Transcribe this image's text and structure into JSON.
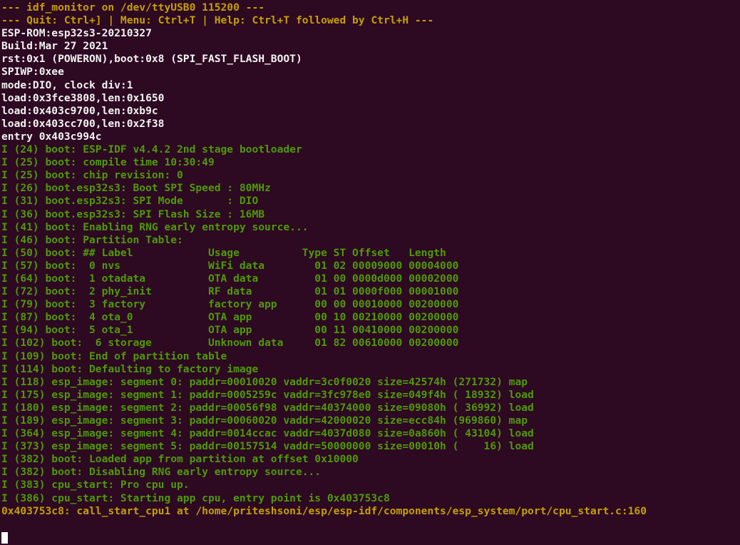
{
  "terminal": {
    "background_color": "#2d0922",
    "colors": {
      "yellow": "#c4a000",
      "white": "#f2f2f2",
      "green": "#4e9a06",
      "cursor": "#ffffff"
    },
    "device": "/dev/ttyUSB0",
    "baud": "115200",
    "cursor_glyph": "block-cursor"
  },
  "lines": [
    {
      "color": "yellow",
      "text": "--- idf_monitor on /dev/ttyUSB0 115200 ---"
    },
    {
      "color": "yellow",
      "text": "--- Quit: Ctrl+] | Menu: Ctrl+T | Help: Ctrl+T followed by Ctrl+H ---"
    },
    {
      "color": "white",
      "text": "ESP-ROM:esp32s3-20210327"
    },
    {
      "color": "white",
      "text": "Build:Mar 27 2021"
    },
    {
      "color": "white",
      "text": "rst:0x1 (POWERON),boot:0x8 (SPI_FAST_FLASH_BOOT)"
    },
    {
      "color": "white",
      "text": "SPIWP:0xee"
    },
    {
      "color": "white",
      "text": "mode:DIO, clock div:1"
    },
    {
      "color": "white",
      "text": "load:0x3fce3808,len:0x1650"
    },
    {
      "color": "white",
      "text": "load:0x403c9700,len:0xb9c"
    },
    {
      "color": "white",
      "text": "load:0x403cc700,len:0x2f38"
    },
    {
      "color": "white",
      "text": "entry 0x403c994c"
    },
    {
      "color": "green",
      "text": "I (24) boot: ESP-IDF v4.4.2 2nd stage bootloader"
    },
    {
      "color": "green",
      "text": "I (25) boot: compile time 10:30:49"
    },
    {
      "color": "green",
      "text": "I (25) boot: chip revision: 0"
    },
    {
      "color": "green",
      "text": "I (26) boot.esp32s3: Boot SPI Speed : 80MHz"
    },
    {
      "color": "green",
      "text": "I (31) boot.esp32s3: SPI Mode       : DIO"
    },
    {
      "color": "green",
      "text": "I (36) boot.esp32s3: SPI Flash Size : 16MB"
    },
    {
      "color": "green",
      "text": "I (41) boot: Enabling RNG early entropy source..."
    },
    {
      "color": "green",
      "text": "I (46) boot: Partition Table:"
    },
    {
      "color": "green",
      "text": "I (50) boot: ## Label            Usage          Type ST Offset   Length"
    },
    {
      "color": "green",
      "text": "I (57) boot:  0 nvs              WiFi data        01 02 00009000 00004000"
    },
    {
      "color": "green",
      "text": "I (64) boot:  1 otadata          OTA data         01 00 0000d000 00002000"
    },
    {
      "color": "green",
      "text": "I (72) boot:  2 phy_init         RF data          01 01 0000f000 00001000"
    },
    {
      "color": "green",
      "text": "I (79) boot:  3 factory          factory app      00 00 00010000 00200000"
    },
    {
      "color": "green",
      "text": "I (87) boot:  4 ota_0            OTA app          00 10 00210000 00200000"
    },
    {
      "color": "green",
      "text": "I (94) boot:  5 ota_1            OTA app          00 11 00410000 00200000"
    },
    {
      "color": "green",
      "text": "I (102) boot:  6 storage         Unknown data     01 82 00610000 00200000"
    },
    {
      "color": "green",
      "text": "I (109) boot: End of partition table"
    },
    {
      "color": "green",
      "text": "I (114) boot: Defaulting to factory image"
    },
    {
      "color": "green",
      "text": "I (118) esp_image: segment 0: paddr=00010020 vaddr=3c0f0020 size=42574h (271732) map"
    },
    {
      "color": "green",
      "text": "I (175) esp_image: segment 1: paddr=0005259c vaddr=3fc978e0 size=049f4h ( 18932) load"
    },
    {
      "color": "green",
      "text": "I (180) esp_image: segment 2: paddr=00056f98 vaddr=40374000 size=09080h ( 36992) load"
    },
    {
      "color": "green",
      "text": "I (189) esp_image: segment 3: paddr=00060020 vaddr=42000020 size=ecc84h (969860) map"
    },
    {
      "color": "green",
      "text": "I (364) esp_image: segment 4: paddr=0014ccac vaddr=4037d080 size=0a860h ( 43104) load"
    },
    {
      "color": "green",
      "text": "I (373) esp_image: segment 5: paddr=00157514 vaddr=50000000 size=00010h (    16) load"
    },
    {
      "color": "green",
      "text": "I (382) boot: Loaded app from partition at offset 0x10000"
    },
    {
      "color": "green",
      "text": "I (382) boot: Disabling RNG early entropy source..."
    },
    {
      "color": "green",
      "text": "I (383) cpu_start: Pro cpu up."
    },
    {
      "color": "green",
      "text": "I (386) cpu_start: Starting app cpu, entry point is 0x403753c8"
    },
    {
      "color": "yellow",
      "text": "0x403753c8: call_start_cpu1 at /home/priteshsoni/esp/esp-idf/components/esp_system/port/cpu_start.c:160"
    },
    {
      "color": "none",
      "text": ""
    }
  ]
}
